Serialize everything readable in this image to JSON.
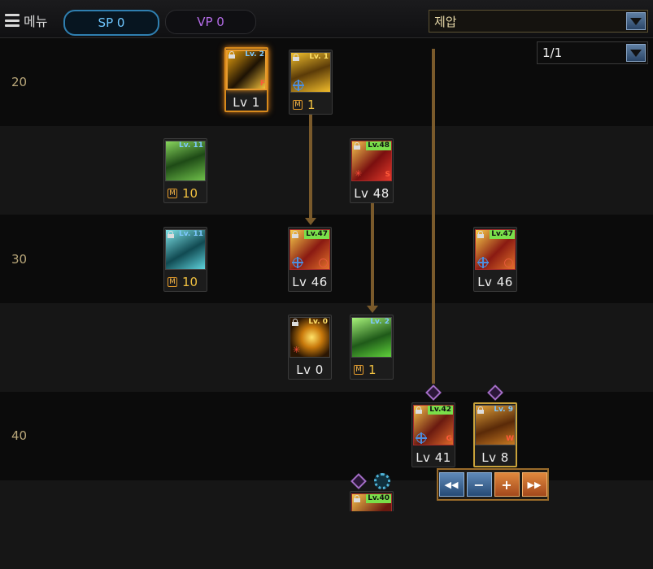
{
  "header": {
    "menu_label": "메뉴",
    "sp_label": "SP 0",
    "vp_label": "VP 0",
    "filter_value": "제압",
    "page_value": "1/1"
  },
  "levels": [
    "20",
    "30",
    "40"
  ],
  "skills": {
    "s1": {
      "req": "Lv. 2",
      "level": "Lv 1",
      "corner": "F"
    },
    "s2": {
      "req": "Lv. 1",
      "mastery": "1"
    },
    "s3": {
      "req": "Lv. 11",
      "mastery": "10"
    },
    "s4": {
      "req": "Lv.48",
      "level": "Lv 48",
      "corner": "S"
    },
    "s5": {
      "req": "Lv. 11",
      "mastery": "10"
    },
    "s6": {
      "req": "Lv.47",
      "level": "Lv 46"
    },
    "s7": {
      "req": "Lv.47",
      "level": "Lv 46"
    },
    "s8": {
      "req": "Lv. 0",
      "level": "Lv 0"
    },
    "s9": {
      "req": "Lv. 2",
      "mastery": "1"
    },
    "s10": {
      "req": "Lv.42",
      "level": "Lv 41",
      "corner": "G"
    },
    "s11": {
      "req": "Lv. 9",
      "level": "Lv 8",
      "corner": "W"
    },
    "s12": {
      "req": "Lv.40"
    }
  },
  "mastery_badge": "M",
  "controls": {
    "first": "◀◀",
    "minus": "−",
    "plus": "+",
    "last": "▶▶"
  },
  "colors": {
    "accent_blue": "#2f7fb0",
    "vp_purple": "#b36be6",
    "connector": "#7a5a2b",
    "selected_border": "#d88a1c"
  }
}
